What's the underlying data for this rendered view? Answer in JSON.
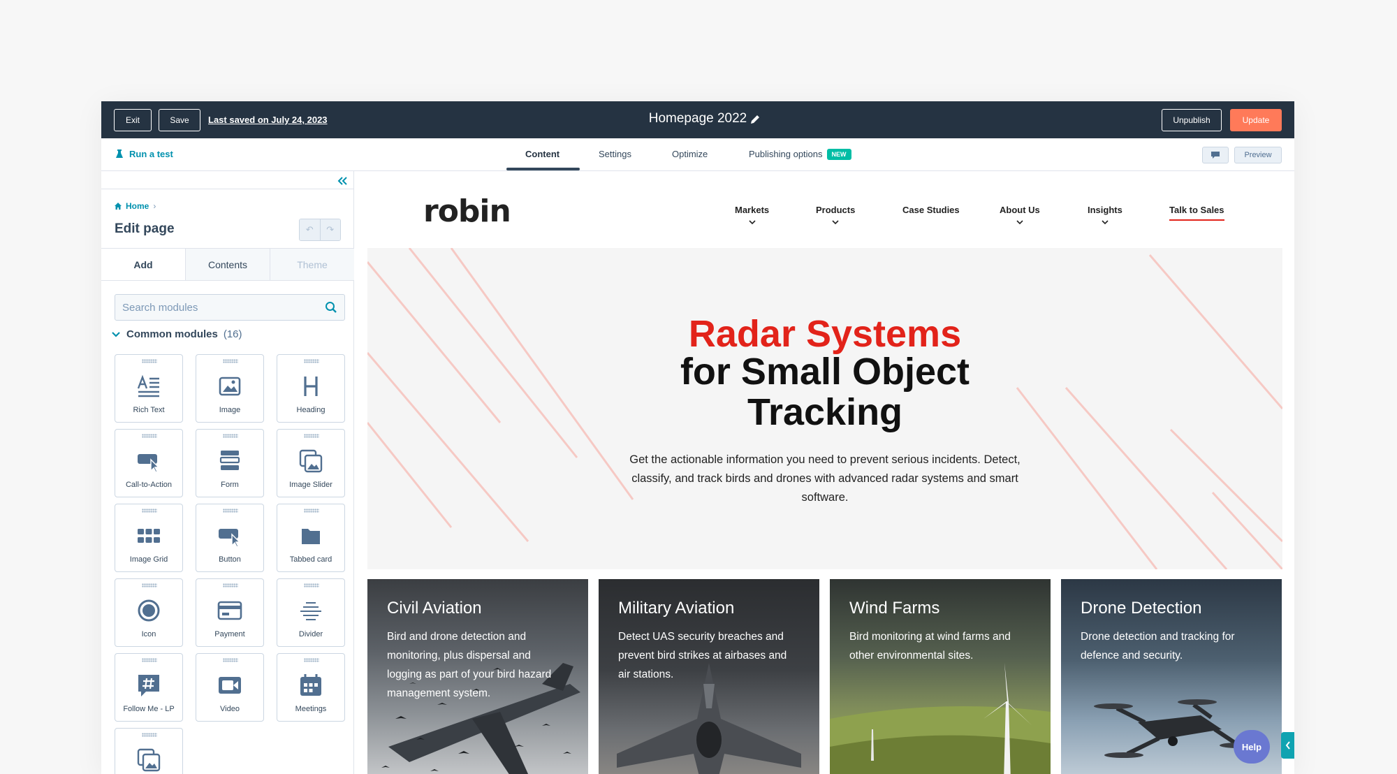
{
  "topbar": {
    "exit_label": "Exit",
    "save_label": "Save",
    "last_saved": "Last saved on July 24, 2023",
    "page_title": "Homepage 2022",
    "unpublish_label": "Unpublish",
    "update_label": "Update"
  },
  "subbar": {
    "run_test": "Run a test",
    "tabs": [
      {
        "label": "Content"
      },
      {
        "label": "Settings"
      },
      {
        "label": "Optimize"
      },
      {
        "label": "Publishing options"
      }
    ],
    "new_badge": "NEW",
    "preview_label": "Preview"
  },
  "sidebar": {
    "breadcrumb": "Home",
    "title": "Edit page",
    "tabs": [
      "Add",
      "Contents",
      "Theme"
    ],
    "search_placeholder": "Search modules",
    "section_title": "Common modules",
    "section_count": "(16)",
    "modules": [
      {
        "label": "Rich Text",
        "icon": "rich-text-icon"
      },
      {
        "label": "Image",
        "icon": "image-icon"
      },
      {
        "label": "Heading",
        "icon": "heading-icon"
      },
      {
        "label": "Call-to-Action",
        "icon": "cta-icon"
      },
      {
        "label": "Form",
        "icon": "form-icon"
      },
      {
        "label": "Image Slider",
        "icon": "image-slider-icon"
      },
      {
        "label": "Image Grid",
        "icon": "image-grid-icon"
      },
      {
        "label": "Button",
        "icon": "button-icon"
      },
      {
        "label": "Tabbed card",
        "icon": "folder-icon"
      },
      {
        "label": "Icon",
        "icon": "circle-icon"
      },
      {
        "label": "Payment",
        "icon": "payment-icon"
      },
      {
        "label": "Divider",
        "icon": "divider-icon"
      },
      {
        "label": "Follow Me - LP",
        "icon": "hashtag-icon"
      },
      {
        "label": "Video",
        "icon": "video-icon"
      },
      {
        "label": "Meetings",
        "icon": "calendar-icon"
      },
      {
        "label": "",
        "icon": "image-slider-icon"
      }
    ]
  },
  "site": {
    "logo": "robin",
    "nav": [
      "Markets",
      "Products",
      "Case Studies",
      "About Us",
      "Insights",
      "Talk to Sales"
    ],
    "hero_title_red": "Radar Systems",
    "hero_title_black_1": "for Small Object",
    "hero_title_black_2": "Tracking",
    "hero_text": "Get the actionable information you need to prevent serious incidents. Detect, classify, and track birds and drones with advanced radar systems and smart software.",
    "cards": [
      {
        "title": "Civil Aviation",
        "text": "Bird and drone detection and monitoring, plus dispersal and logging as part of your bird hazard management system."
      },
      {
        "title": "Military Aviation",
        "text": "Detect UAS security breaches and prevent bird strikes at airbases and air stations."
      },
      {
        "title": "Wind Farms",
        "text": "Bird monitoring at wind farms and other environmental sites."
      },
      {
        "title": "Drone Detection",
        "text": "Drone detection and tracking for defence and security."
      }
    ]
  },
  "help_label": "Help",
  "colors": {
    "topbar": "#253342",
    "update": "#ff7a59",
    "accent": "#0091ae",
    "brand_red": "#e2231a",
    "badge": "#00bda5"
  }
}
